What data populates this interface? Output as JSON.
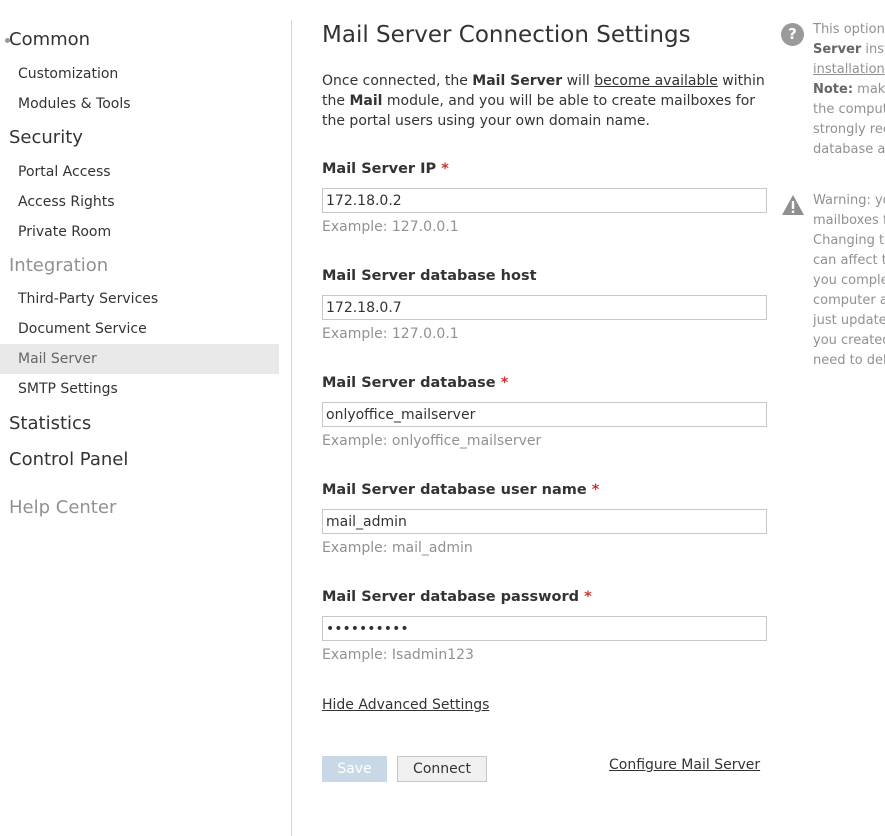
{
  "sidebar": {
    "common": "Common",
    "customization": "Customization",
    "modules_tools": "Modules & Tools",
    "security": "Security",
    "portal_access": "Portal Access",
    "access_rights": "Access Rights",
    "private_room": "Private Room",
    "integration": "Integration",
    "third_party": "Third-Party Services",
    "document_service": "Document Service",
    "mail_server": "Mail Server",
    "smtp_settings": "SMTP Settings",
    "statistics": "Statistics",
    "control_panel": "Control Panel",
    "help_center": "Help Center"
  },
  "main": {
    "title": "Mail Server Connection Settings",
    "intro": {
      "p1": "Once connected, the ",
      "b1": "Mail Server",
      "p2": " will ",
      "link": "become available",
      "p3": " within the ",
      "b2": "Mail",
      "p4": " module, and you will be able to create mailboxes for the portal users using your own domain name."
    },
    "fields": {
      "ip": {
        "label": "Mail Server IP",
        "value": "172.18.0.2",
        "example": "Example: 127.0.0.1"
      },
      "db_host": {
        "label": "Mail Server database host",
        "value": "172.18.0.7",
        "example": "Example: 127.0.0.1"
      },
      "db": {
        "label": "Mail Server database",
        "value": "onlyoffice_mailserver",
        "example": "Example: onlyoffice_mailserver"
      },
      "db_user": {
        "label": "Mail Server database user name",
        "value": "mail_admin",
        "example": "Example: mail_admin"
      },
      "db_pass": {
        "label": "Mail Server database password",
        "value": "••••••••••",
        "example": "Example: Isadmin123"
      }
    },
    "required_mark": "*",
    "hide_advanced": "Hide Advanced Settings",
    "save": "Save",
    "connect": "Connect",
    "configure": "Configure Mail Server"
  },
  "help": {
    "info_icon_glyph": "?",
    "info": {
      "l1": "This option",
      "l2b": "Server",
      "l2": " inst",
      "l3": "installation",
      "l4b": "Note:",
      "l4": " make",
      "l5": "the comput",
      "l6": "strongly rec",
      "l7": "database ac"
    },
    "warning": {
      "l1": "Warning: yo",
      "l2": "mailboxes f",
      "l3": "Changing th",
      "l4": "can affect t",
      "l5": "you comple",
      "l6": "computer a",
      "l7": "just update",
      "l8": "you created",
      "l9": "need to del"
    }
  }
}
